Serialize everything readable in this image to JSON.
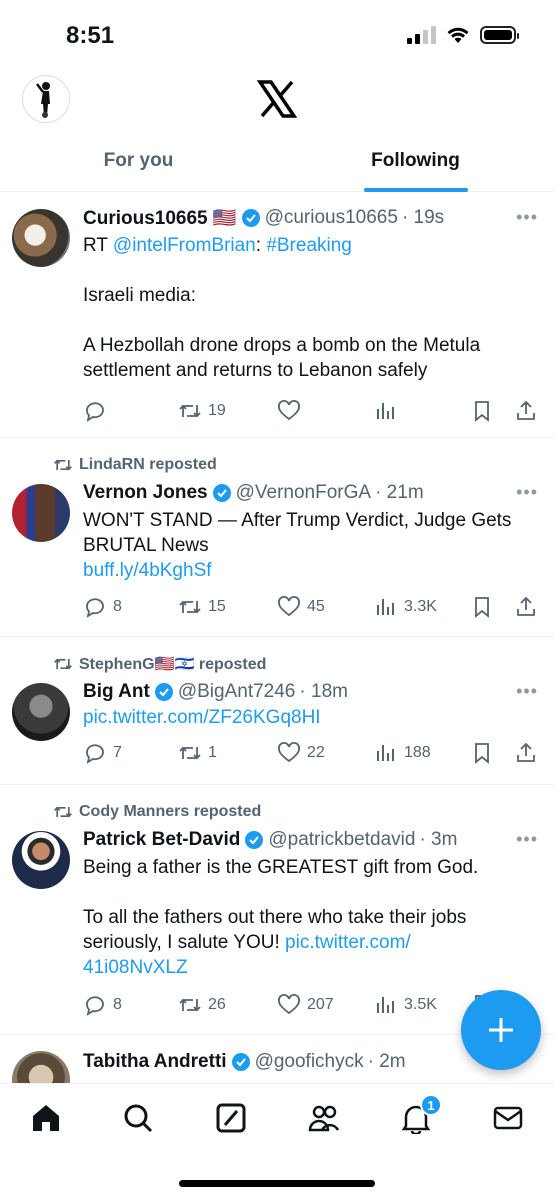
{
  "status": {
    "time": "8:51"
  },
  "tabs": [
    {
      "label": "For you",
      "active": false
    },
    {
      "label": "Following",
      "active": true
    }
  ],
  "posts": [
    {
      "repost_by": "",
      "name": "Curious10665 🇺🇸",
      "handle": "@curious10665",
      "time": "· 19s",
      "text_prefix": "RT ",
      "mention": "@intelFromBrian",
      "text_mid": ": ",
      "hashtag": "#Breaking",
      "text": "Israeli media:\n\nA Hezbollah drone drops a bomb on the Metula settlement and returns to Lebanon safely",
      "replies": "",
      "reposts": "19",
      "likes": "",
      "views": ""
    },
    {
      "repost_by": "LindaRN reposted",
      "name": "Vernon Jones",
      "handle": "@VernonForGA",
      "time": "· 21m",
      "text": "WON'T STAND — After Trump Verdict, Judge Gets BRUTAL News",
      "link": "buff.ly/4bKghSf",
      "replies": "8",
      "reposts": "15",
      "likes": "45",
      "views": "3.3K"
    },
    {
      "repost_by": "StephenG🇺🇸🇮🇱 reposted",
      "name": "Big Ant",
      "handle": "@BigAnt7246",
      "time": "· 18m",
      "link": "pic.twitter.com/ZF26KGq8HI",
      "replies": "7",
      "reposts": "1",
      "likes": "22",
      "views": "188"
    },
    {
      "repost_by": "Cody Manners reposted",
      "name": "Patrick Bet-David",
      "handle": "@patrickbetdavid",
      "time": "· 3m",
      "text": "Being a father is the GREATEST gift from God.\n\nTo all the fathers out there who take their jobs seriously, I salute YOU! ",
      "link": "pic.twitter.com/\n41i08NvXLZ",
      "replies": "8",
      "reposts": "26",
      "likes": "207",
      "views": "3.5K"
    },
    {
      "name": "Tabitha Andretti",
      "handle": "@goofichyck",
      "time": "· 2m"
    }
  ],
  "nav": {
    "notification_count": "1"
  },
  "colors": {
    "accent": "#1d9bf0",
    "text": "#0f1419",
    "muted": "#536471"
  },
  "icons": [
    "profile-avatar",
    "x-logo",
    "reply-icon",
    "repost-icon",
    "like-icon",
    "views-icon",
    "bookmark-icon",
    "share-icon",
    "verified-badge-icon",
    "compose-plus-icon",
    "home-icon",
    "search-icon",
    "grok-icon",
    "communities-icon",
    "bell-icon",
    "mail-icon"
  ]
}
